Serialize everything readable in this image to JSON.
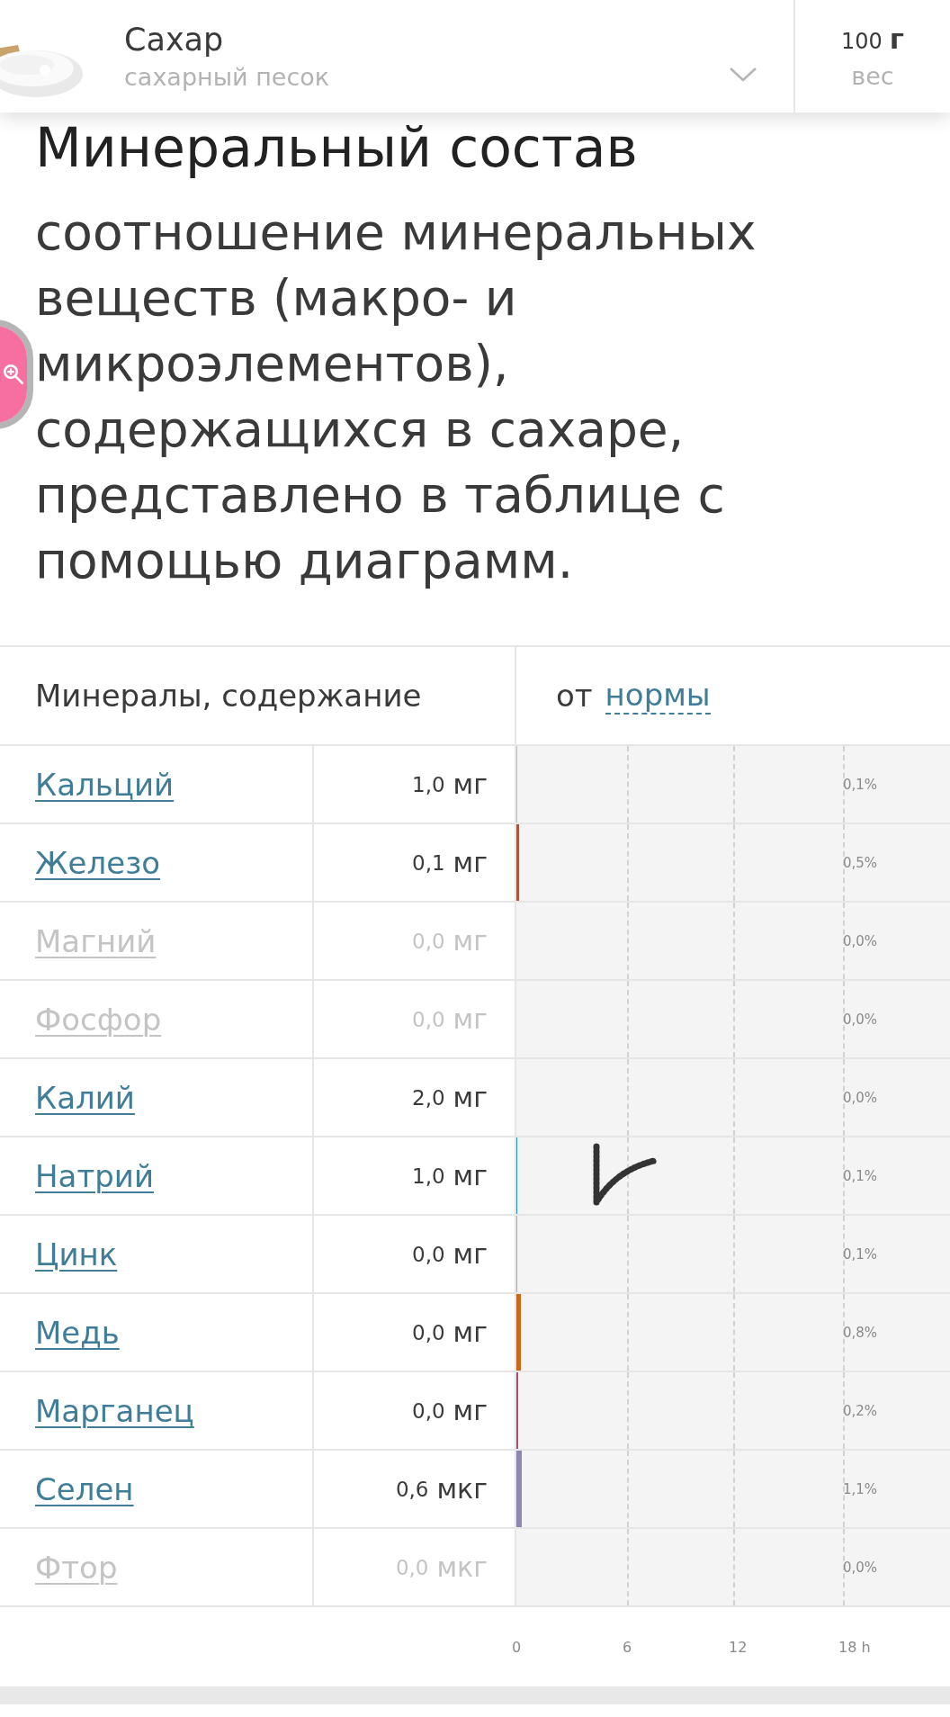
{
  "header": {
    "title": "Сахар",
    "subtitle": "сахарный песок",
    "amount": "100",
    "unit": "г",
    "amount_label": "вес"
  },
  "section": {
    "title": "Минеральный состав",
    "description": "соотношение минеральных веществ (макро- и микроэлементов), содержащихся в сахаре, представлено в таблице с помощью диаграмм."
  },
  "table": {
    "columns": {
      "content": "Минералы, содержание",
      "norm_prefix": "от",
      "norm_link": "нормы"
    },
    "rows": [
      {
        "name": "Кальций",
        "amount": "1,0",
        "unit": "мг",
        "percent": "0,1%",
        "level": 0.001,
        "color": "#bbbbbb",
        "muted": false
      },
      {
        "name": "Железо",
        "amount": "0,1",
        "unit": "мг",
        "percent": "0,5%",
        "level": 0.005,
        "color": "#a8553e",
        "muted": false
      },
      {
        "name": "Магний",
        "amount": "0,0",
        "unit": "мг",
        "percent": "0,0%",
        "muted": true
      },
      {
        "name": "Фосфор",
        "amount": "0,0",
        "unit": "мг",
        "percent": "0,0%",
        "muted": true
      },
      {
        "name": "Калий",
        "amount": "2,0",
        "unit": "мг",
        "percent": "0,0%",
        "muted": false
      },
      {
        "name": "Натрий",
        "amount": "1,0",
        "unit": "мг",
        "percent": "0,1%",
        "level": 0.001,
        "color": "#1b8fd2",
        "muted": false
      },
      {
        "name": "Цинк",
        "amount": "0,0",
        "unit": "мг",
        "percent": "0,1%",
        "level": 0.001,
        "color": "#aaaaaa",
        "muted": false
      },
      {
        "name": "Медь",
        "amount": "0,0",
        "unit": "мг",
        "percent": "0,8%",
        "level": 0.008,
        "color": "#c9691c",
        "muted": false
      },
      {
        "name": "Марганец",
        "amount": "0,0",
        "unit": "мг",
        "percent": "0,2%",
        "level": 0.002,
        "color": "#a3506f",
        "muted": false
      },
      {
        "name": "Селен",
        "amount": "0,6",
        "unit": "мкг",
        "percent": "1,1%",
        "level": 0.011,
        "color": "#8b86b3",
        "muted": false
      },
      {
        "name": "Фтор",
        "amount": "0,0",
        "unit": "мкг",
        "percent": "0,0%",
        "muted": true
      }
    ],
    "axis_ticks": [
      "0",
      "6",
      "12",
      "18 h"
    ]
  }
}
